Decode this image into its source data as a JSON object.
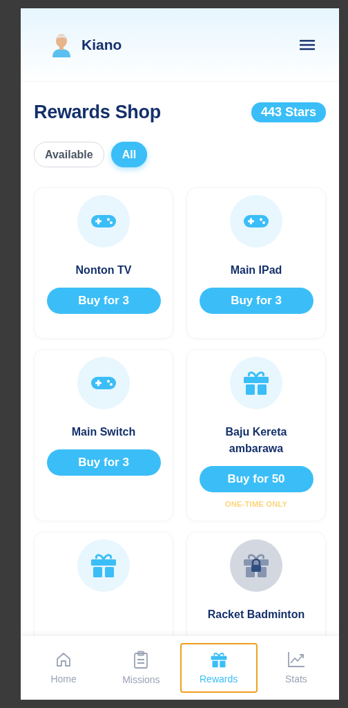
{
  "header": {
    "user_name": "Kiano"
  },
  "title": "Rewards Shop",
  "stars_badge": "443 Stars",
  "filters": [
    {
      "label": "Available",
      "selected": false
    },
    {
      "label": "All",
      "selected": true
    }
  ],
  "rewards": [
    {
      "kind": "gamepad",
      "name": "Nonton TV",
      "button": "Buy for 3",
      "locked": false
    },
    {
      "kind": "gamepad",
      "name": "Main IPad",
      "button": "Buy for 3",
      "locked": false
    },
    {
      "kind": "gamepad",
      "name": "Main Switch",
      "button": "Buy for 3",
      "locked": false
    },
    {
      "kind": "gift",
      "name": "Baju Kereta ambarawa",
      "button": "Buy for 50",
      "note": "ONE-TIME ONLY",
      "locked": false
    },
    {
      "kind": "gift",
      "locked": false
    },
    {
      "kind": "gift",
      "name": "Racket Badminton",
      "locked": true
    }
  ],
  "nav": [
    {
      "kind": "home",
      "label": "Home",
      "selected": false
    },
    {
      "kind": "missions",
      "label": "Missions",
      "selected": false
    },
    {
      "kind": "rewards",
      "label": "Rewards",
      "selected": true
    },
    {
      "kind": "stats",
      "label": "Stats",
      "selected": false
    }
  ]
}
